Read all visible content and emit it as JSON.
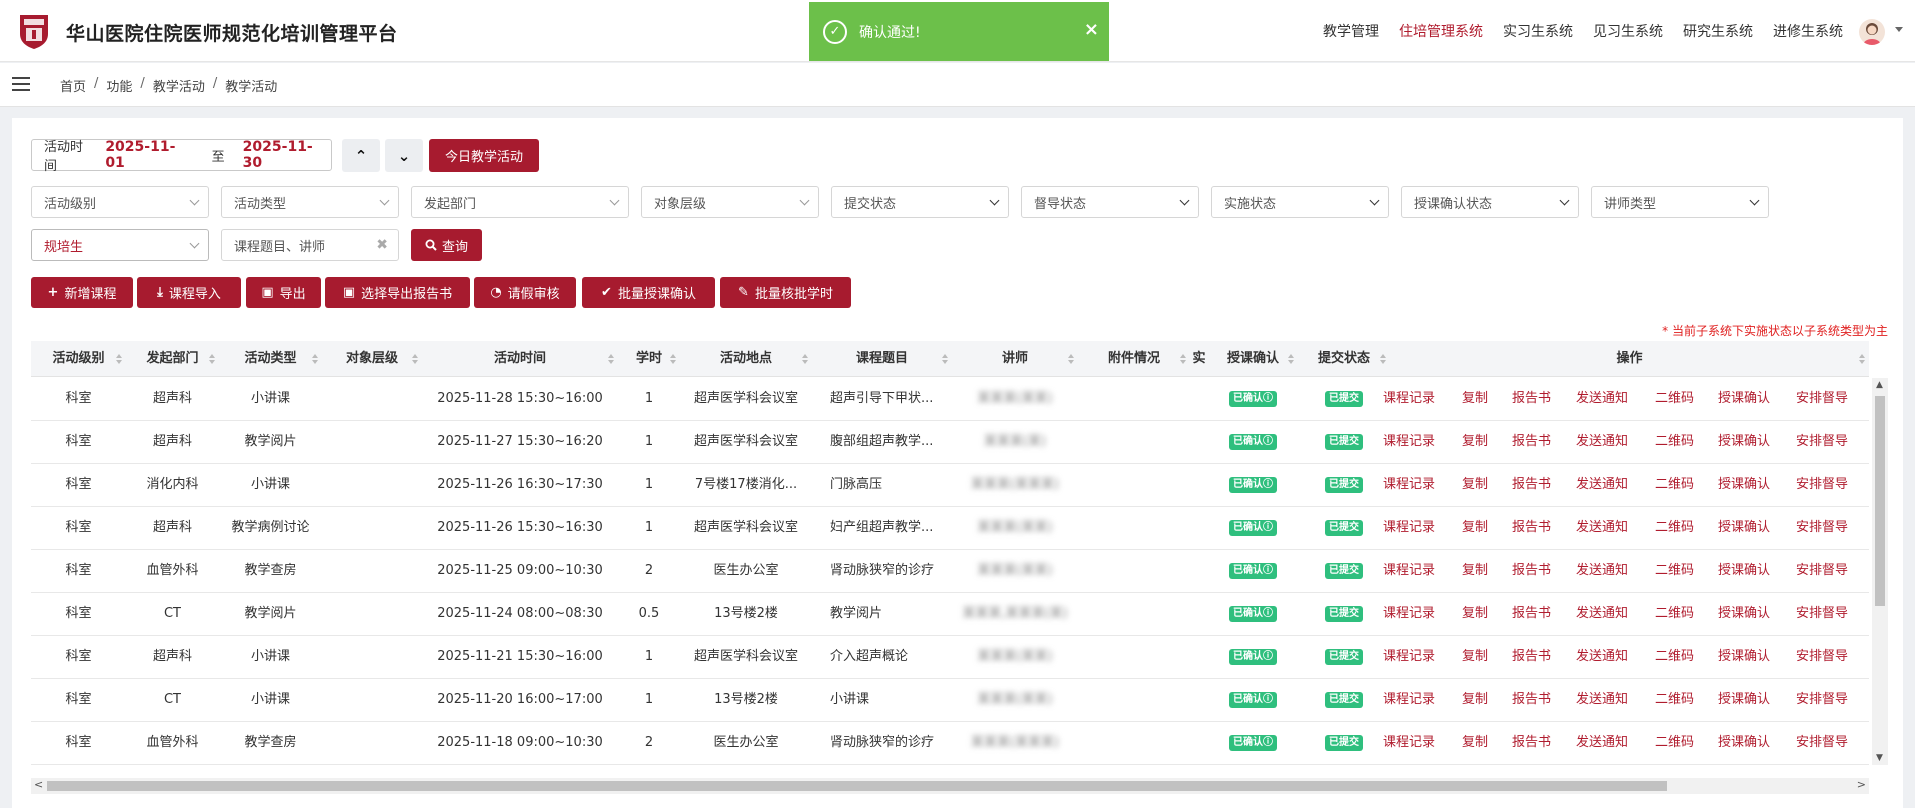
{
  "header": {
    "title": "华山医院住院医师规范化培训管理平台",
    "nav": [
      "教学管理",
      "住培管理系统",
      "实习生系统",
      "见习生系统",
      "研究生系统",
      "进修生系统"
    ],
    "active_nav": "住培管理系统"
  },
  "toast": {
    "message": "确认通过!",
    "close": "×"
  },
  "breadcrumb": [
    "首页",
    "功能",
    "教学活动",
    "教学活动"
  ],
  "filters": {
    "date_label": "活动时间",
    "date_from": "2025-11-01",
    "date_sep": "至",
    "date_to": "2025-11-30",
    "today_button": "今日教学活动",
    "selects": [
      "活动级别",
      "活动类型",
      "发起部门",
      "对象层级",
      "提交状态",
      "督导状态",
      "实施状态",
      "授课确认状态",
      "讲师类型"
    ],
    "role_select": "规培生",
    "search_placeholder": "课程题目、讲师",
    "query_button": "查询"
  },
  "actions": [
    "新增课程",
    "课程导入",
    "导出",
    "选择导出报告书",
    "请假审核",
    "批量授课确认",
    "批量核批学时"
  ],
  "note": "* 当前子系统下实施状态以子系统类型为主",
  "table": {
    "columns": [
      "活动级别",
      "发起部门",
      "活动类型",
      "对象层级",
      "活动时间",
      "学时",
      "活动地点",
      "课程题目",
      "讲师",
      "附件情况",
      "实",
      "授课确认",
      "提交状态",
      "操作"
    ],
    "confirm_badge": "已确认ⓘ",
    "submit_badge": "已提交",
    "operations": [
      "课程记录",
      "复制",
      "报告书",
      "发送通知",
      "二维码",
      "授课确认",
      "安排督导"
    ],
    "rows": [
      {
        "level": "科室",
        "dept": "超声科",
        "type": "小讲课",
        "time": "2025-11-28  15:30~16:00",
        "hours": "1",
        "place": "超声医学科会议室",
        "topic": "超声引导下甲状...",
        "lecturer": "某某某(某某)"
      },
      {
        "level": "科室",
        "dept": "超声科",
        "type": "教学阅片",
        "time": "2025-11-27  15:30~16:20",
        "hours": "1",
        "place": "超声医学科会议室",
        "topic": "腹部组超声教学...",
        "lecturer": "某某某(某)"
      },
      {
        "level": "科室",
        "dept": "消化内科",
        "type": "小讲课",
        "time": "2025-11-26  16:30~17:30",
        "hours": "1",
        "place": "7号楼17楼消化...",
        "topic": "门脉高压",
        "lecturer": "某某某(某某某)"
      },
      {
        "level": "科室",
        "dept": "超声科",
        "type": "教学病例讨论",
        "time": "2025-11-26  15:30~16:30",
        "hours": "1",
        "place": "超声医学科会议室",
        "topic": "妇产组超声教学...",
        "lecturer": "某某某(某某)"
      },
      {
        "level": "科室",
        "dept": "血管外科",
        "type": "教学查房",
        "time": "2025-11-25  09:00~10:30",
        "hours": "2",
        "place": "医生办公室",
        "topic": "肾动脉狭窄的诊疗",
        "lecturer": "某某某(某某)"
      },
      {
        "level": "科室",
        "dept": "CT",
        "type": "教学阅片",
        "time": "2025-11-24  08:00~08:30",
        "hours": "0.5",
        "place": "13号楼2楼",
        "topic": "教学阅片",
        "lecturer": "某某某,某某某(某)"
      },
      {
        "level": "科室",
        "dept": "超声科",
        "type": "小讲课",
        "time": "2025-11-21  15:30~16:00",
        "hours": "1",
        "place": "超声医学科会议室",
        "topic": "介入超声概论",
        "lecturer": "某某某(某某)"
      },
      {
        "level": "科室",
        "dept": "CT",
        "type": "小讲课",
        "time": "2025-11-20  16:00~17:00",
        "hours": "1",
        "place": "13号楼2楼",
        "topic": "小讲课",
        "lecturer": "某某某(某某)"
      },
      {
        "level": "科室",
        "dept": "血管外科",
        "type": "教学查房",
        "time": "2025-11-18  09:00~10:30",
        "hours": "2",
        "place": "医生办公室",
        "topic": "肾动脉狭窄的诊疗",
        "lecturer": "某某某(某某某)"
      }
    ]
  },
  "colors": {
    "brand_red": "#a71b2f",
    "link_red": "#b01c2e",
    "toast_green": "#6cc04a",
    "badge_green": "#2fbf7e"
  }
}
